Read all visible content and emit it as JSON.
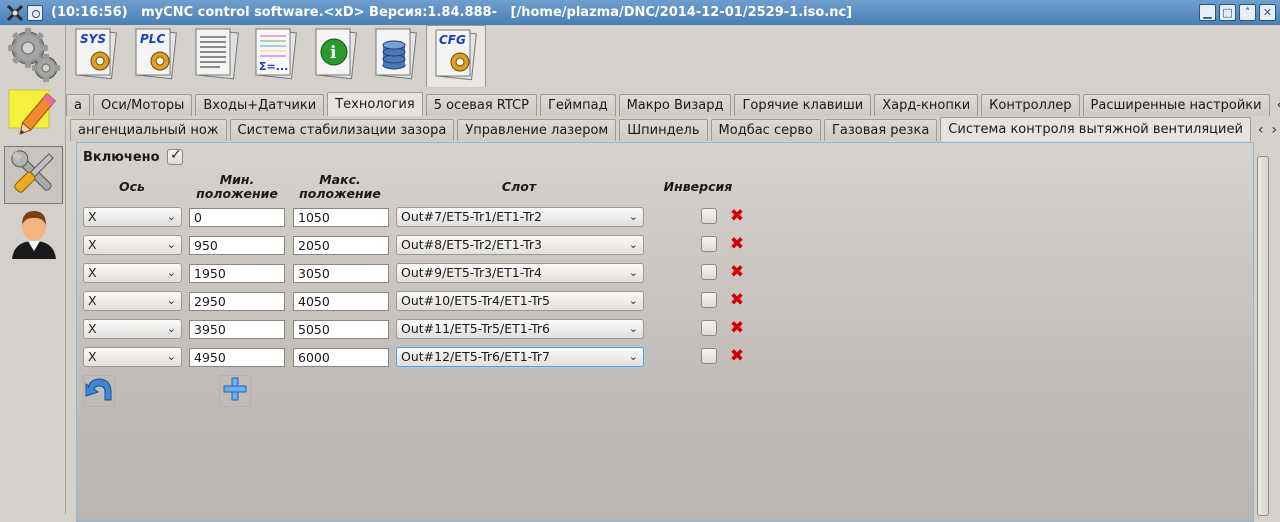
{
  "window": {
    "title": "(10:16:56)   myCNC control software.<xD> Версия:1.84.888-   [/home/plazma/DNC/2014-12-01/2529-1.iso.nc]",
    "controls": [
      "minimize",
      "maximize",
      "restore",
      "close"
    ]
  },
  "sidebar": {
    "items": [
      {
        "icon": "gears-icon"
      },
      {
        "icon": "pencil-icon"
      },
      {
        "icon": "tools-icon",
        "active": true
      },
      {
        "icon": "user-icon"
      }
    ]
  },
  "toolbar": {
    "items": [
      {
        "icon": "sys-icon",
        "label": "SYS"
      },
      {
        "icon": "plc-icon",
        "label": "PLC"
      },
      {
        "icon": "document-icon"
      },
      {
        "icon": "formula-icon",
        "label": "Σ=..."
      },
      {
        "icon": "info-icon",
        "label": "i"
      },
      {
        "icon": "database-icon"
      },
      {
        "icon": "cfg-icon",
        "label": "CFG",
        "active": true
      }
    ]
  },
  "tabs_row1": {
    "items": [
      "а",
      "Оси/Моторы",
      "Входы+Датчики",
      "Технология",
      "5 осевая RTCP",
      "Геймпад",
      "Макро Визард",
      "Горячие клавиши",
      "Хард-кнопки",
      "Контроллер",
      "Расширенные настройки"
    ],
    "selected": "Технология",
    "arrows": [
      "‹",
      "›"
    ]
  },
  "tabs_row2": {
    "items": [
      "ангенциальный нож",
      "Система стабилизации зазора",
      "Управление лазером",
      "Шпиндель",
      "Модбас серво",
      "Газовая резка",
      "Система контроля вытяжной вентиляцией"
    ],
    "selected": "Система контроля вытяжной вентиляцией",
    "arrows": [
      "‹",
      "›"
    ]
  },
  "form": {
    "enabled_label": "Включено",
    "enabled": true,
    "headers": {
      "axis": "Ось",
      "min_line1": "Мин.",
      "min_line2": "положение",
      "max_line1": "Макс.",
      "max_line2": "положение",
      "slot": "Слот",
      "invert": "Инверсия"
    },
    "rows": [
      {
        "axis": "X",
        "min": "0",
        "max": "1050",
        "slot": "Out#7/ET5-Tr1/ET1-Tr2",
        "invert": false
      },
      {
        "axis": "X",
        "min": "950",
        "max": "2050",
        "slot": "Out#8/ET5-Tr2/ET1-Tr3",
        "invert": false
      },
      {
        "axis": "X",
        "min": "1950",
        "max": "3050",
        "slot": "Out#9/ET5-Tr3/ET1-Tr4",
        "invert": false
      },
      {
        "axis": "X",
        "min": "2950",
        "max": "4050",
        "slot": "Out#10/ET5-Tr4/ET1-Tr5",
        "invert": false
      },
      {
        "axis": "X",
        "min": "3950",
        "max": "5050",
        "slot": "Out#11/ET5-Tr5/ET1-Tr6",
        "invert": false
      },
      {
        "axis": "X",
        "min": "4950",
        "max": "6000",
        "slot": "Out#12/ET5-Tr6/ET1-Tr7",
        "invert": false
      }
    ],
    "actions": [
      {
        "icon": "undo-icon"
      },
      {
        "icon": "add-icon"
      }
    ]
  },
  "colors": {
    "titlebar": "#4a7fb5",
    "delete": "#d40000",
    "focus": "#5f9ad3"
  }
}
